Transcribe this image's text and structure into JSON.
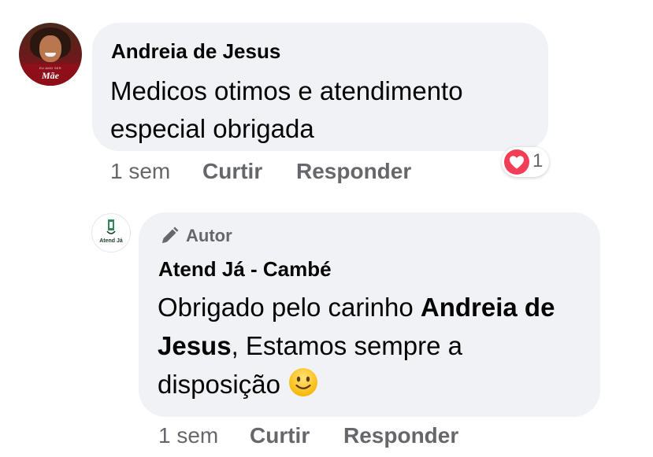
{
  "comment": {
    "author": "Andreia de Jesus",
    "text": "Medicos otimos e atendimento especial obrigada",
    "avatar": {
      "overlay_small": "EU AMO SER",
      "overlay_big": "Mãe"
    },
    "time": "1 sem",
    "like_label": "Curtir",
    "reply_label": "Responder",
    "reaction": {
      "icon": "heart-icon",
      "count": "1",
      "color": "#f33e58"
    }
  },
  "reply": {
    "badge_label": "Autor",
    "badge_icon": "pencil-icon",
    "author": "Atend Já - Cambé",
    "avatar_logo_text": "Atend Já",
    "text_before": "Obrigado pelo carinho ",
    "mention": "Andreia de Jesus",
    "text_after": ", Estamos sempre a disposição ",
    "emoji": "slightly-smiling-face",
    "time": "1 sem",
    "like_label": "Curtir",
    "reply_label": "Responder"
  },
  "colors": {
    "bubble": "#f0f2f5",
    "meta": "#65676b",
    "text": "#050505"
  }
}
